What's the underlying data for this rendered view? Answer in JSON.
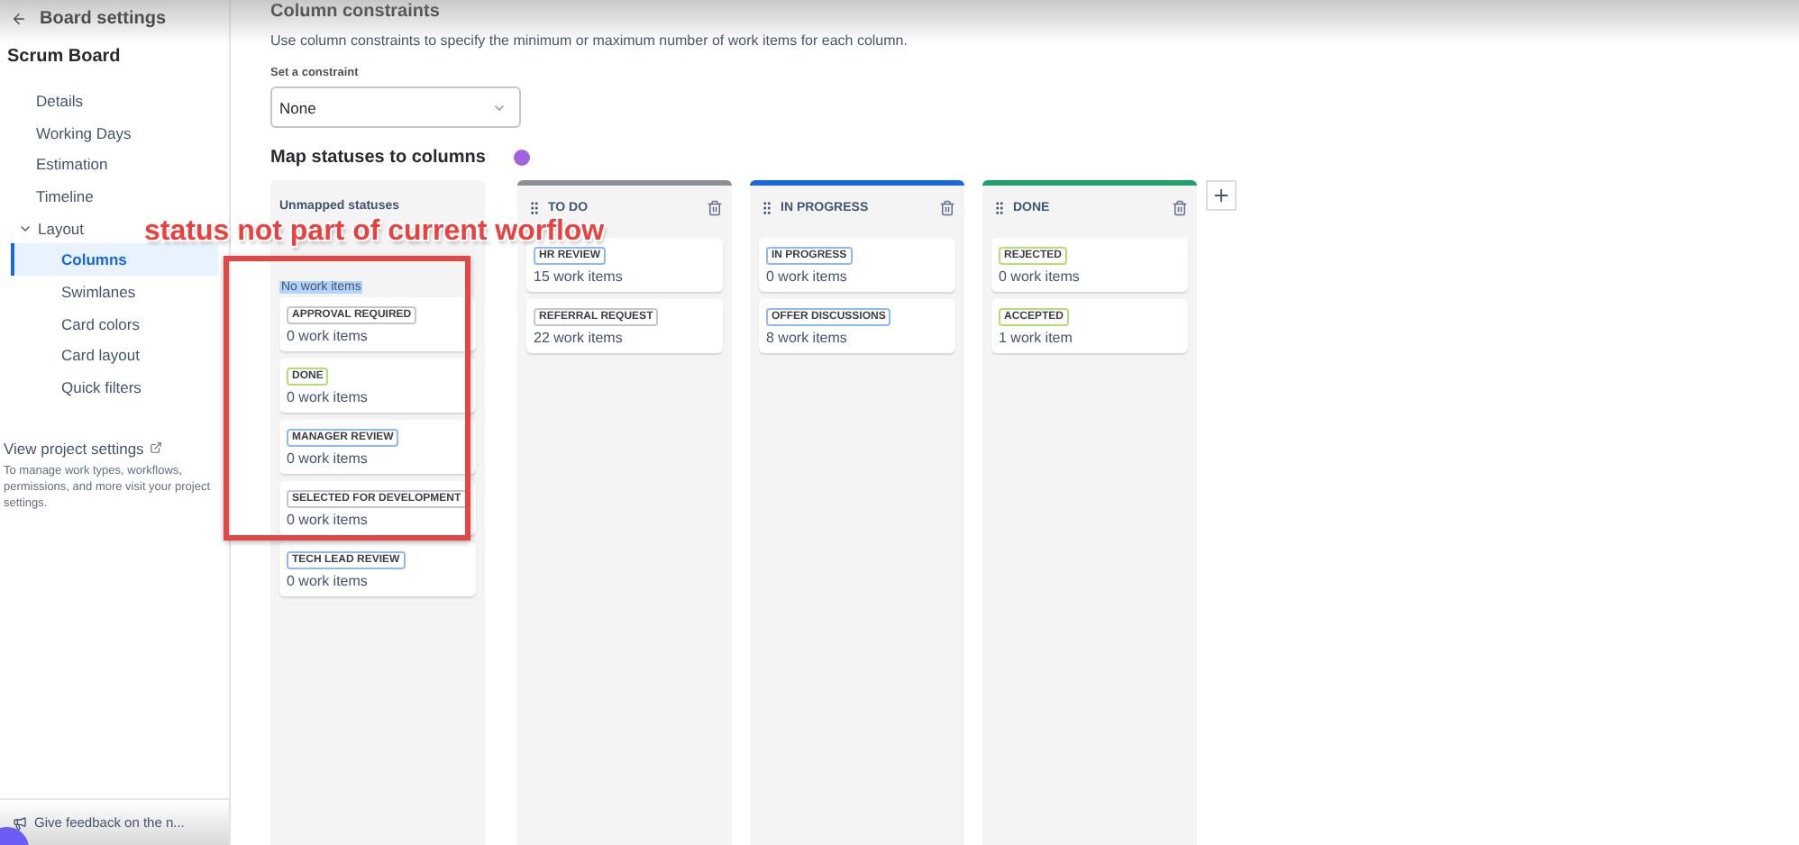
{
  "sidebar": {
    "back_title": "Board settings",
    "board_name": "Scrum Board",
    "items": [
      {
        "label": "Details",
        "selected": false
      },
      {
        "label": "Working Days",
        "selected": false
      },
      {
        "label": "Estimation",
        "selected": false
      },
      {
        "label": "Timeline",
        "selected": false
      },
      {
        "label": "Layout",
        "selected": false,
        "expanded": true,
        "children": [
          {
            "label": "Columns",
            "selected": true
          },
          {
            "label": "Swimlanes",
            "selected": false
          },
          {
            "label": "Card colors",
            "selected": false
          },
          {
            "label": "Card layout",
            "selected": false
          },
          {
            "label": "Quick filters",
            "selected": false
          }
        ]
      }
    ],
    "project_link": "View project settings",
    "project_note": "To manage work types, workflows, permissions, and more visit your project settings.",
    "feedback": "Give feedback on the n..."
  },
  "constraints": {
    "title": "Column constraints",
    "description": "Use column constraints to specify the minimum or maximum number of work items for each column.",
    "field_label": "Set a constraint",
    "value": "None"
  },
  "mapping": {
    "title": "Map statuses to columns",
    "unmapped": {
      "title": "Unmapped statuses",
      "empty_text": "No work items",
      "statuses": [
        {
          "name": "APPROVAL REQUIRED",
          "color": "#c4c6cc",
          "count": "0 work items"
        },
        {
          "name": "DONE",
          "color": "#b3df72",
          "count": "0 work items"
        },
        {
          "name": "MANAGER REVIEW",
          "color": "#8fb8f6",
          "count": "0 work items"
        },
        {
          "name": "SELECTED FOR DEVELOPMENT",
          "color": "#c4c6cc",
          "count": "0 work items"
        },
        {
          "name": "TECH LEAD REVIEW",
          "color": "#8fb8f6",
          "count": "0 work items"
        }
      ]
    },
    "columns": [
      {
        "name": "TO DO",
        "color": "#8c8f97",
        "statuses": [
          {
            "name": "HR REVIEW",
            "color": "#8fb8f6",
            "count": "15 work items"
          },
          {
            "name": "REFERRAL REQUEST",
            "color": "#c4c6cc",
            "count": "22 work items"
          }
        ]
      },
      {
        "name": "IN PROGRESS",
        "color": "#1868db",
        "statuses": [
          {
            "name": "IN PROGRESS",
            "color": "#8fb8f6",
            "count": "0 work items"
          },
          {
            "name": "OFFER DISCUSSIONS",
            "color": "#8fb8f6",
            "count": "8 work items"
          }
        ]
      },
      {
        "name": "DONE",
        "color": "#22a06b",
        "statuses": [
          {
            "name": "REJECTED",
            "color": "#b3df72",
            "count": "0 work items"
          },
          {
            "name": "ACCEPTED",
            "color": "#b3df72",
            "count": "1 work item"
          }
        ]
      }
    ]
  },
  "annotation": {
    "text": "status not part of current worflow"
  }
}
